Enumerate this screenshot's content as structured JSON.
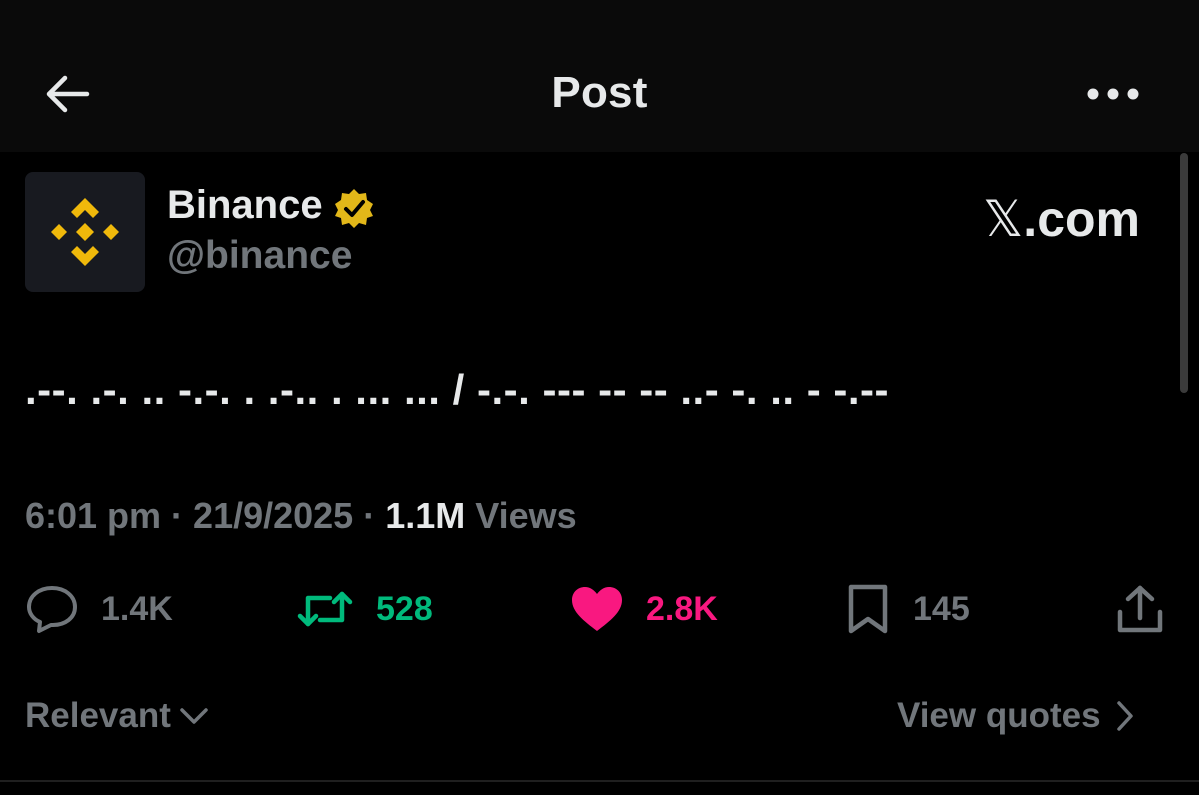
{
  "header": {
    "title": "Post",
    "back_icon": "arrow-left-icon",
    "more_icon": "more-horizontal-icon"
  },
  "post": {
    "author": {
      "name": "Binance",
      "handle": "@binance",
      "avatar": "binance-logo",
      "verified": "gold-verified-badge-icon"
    },
    "brand": {
      "letter": "𝕏",
      "suffix": ".com"
    },
    "text": ".--. .-. .. -.-. . .-.. . ... ... / -.-. --- -- -- ..- -. .. - -.--",
    "timestamp": "6:01 pm · 21/9/2025 · ",
    "views_count": "1.1M",
    "views_label": " Views",
    "stats": {
      "replies": "1.4K",
      "reposts": "528",
      "likes": "2.8K",
      "bookmarks": "145"
    }
  },
  "footer": {
    "sort_label": "Relevant",
    "quotes_label": "View quotes"
  },
  "colors": {
    "background": "#000000",
    "header_background": "#0a0a0a",
    "text_primary": "#e7e9ea",
    "text_secondary": "#71767b",
    "repost_green": "#00ba7c",
    "like_pink": "#f91880",
    "binance_yellow": "#f0b90b",
    "verified_gold": "#e2b719"
  }
}
